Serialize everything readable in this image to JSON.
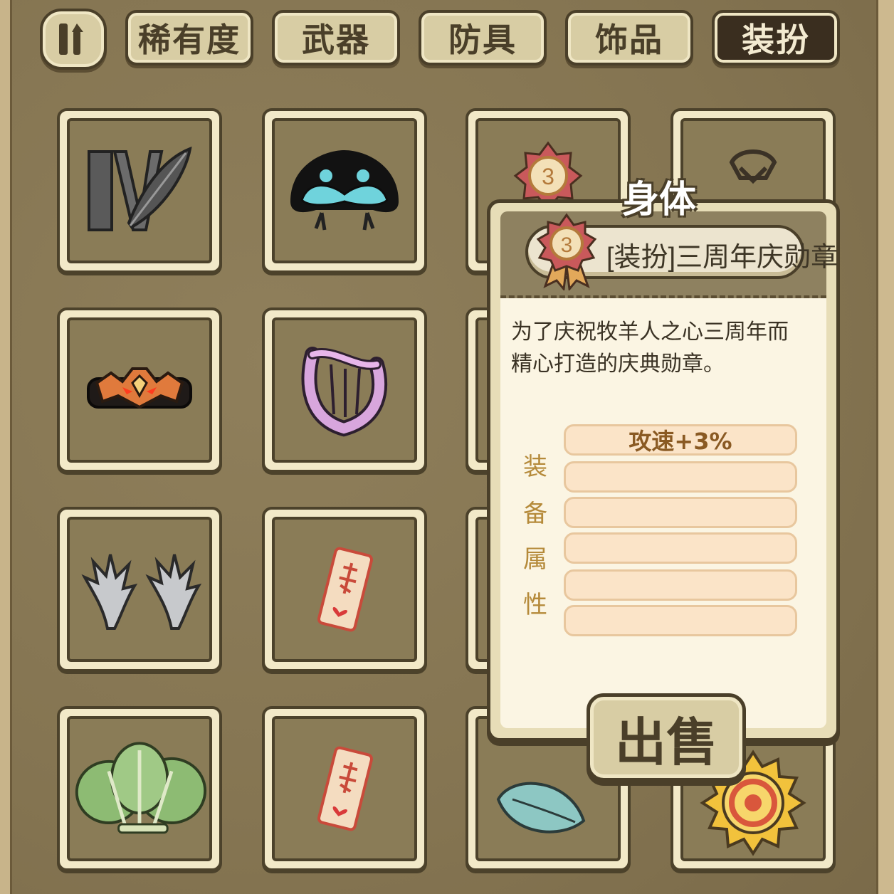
{
  "tabs": {
    "sort_icon": "sort-toggle-icon",
    "rarity": "稀有度",
    "weapon": "武器",
    "armor": "防具",
    "accessory": "饰品",
    "costume": "装扮",
    "active": "costume"
  },
  "grid": {
    "items": [
      {
        "icon": "feather-tier-iv-icon"
      },
      {
        "icon": "black-blob-creature-icon"
      },
      {
        "icon": "anniversary-medal-icon"
      },
      {
        "icon": "necklace-icon"
      },
      {
        "icon": "demon-crown-icon"
      },
      {
        "icon": "pink-lyre-icon"
      },
      {
        "icon": "partial-item-icon"
      },
      {
        "icon": "hidden-item-icon"
      },
      {
        "icon": "silver-claws-icon"
      },
      {
        "icon": "red-talisman-icon"
      },
      {
        "icon": "partial-item-icon"
      },
      {
        "icon": "hidden-item-icon"
      },
      {
        "icon": "cabbage-icon"
      },
      {
        "icon": "red-talisman-icon"
      },
      {
        "icon": "blue-leaf-icon"
      },
      {
        "icon": "sun-swirl-icon"
      }
    ]
  },
  "popup": {
    "slot_label": "身体",
    "item_name": "[装扮]三周年庆勋章",
    "description_line1": "为了庆祝牧羊人之心三周年而",
    "description_line2": "精心打造的庆典勋章。",
    "attr_label_chars": [
      "装",
      "备",
      "属",
      "性"
    ],
    "attributes": [
      "攻速+3%",
      "",
      "",
      "",
      "",
      ""
    ],
    "sell_button": "出售",
    "medal_number": "3"
  }
}
